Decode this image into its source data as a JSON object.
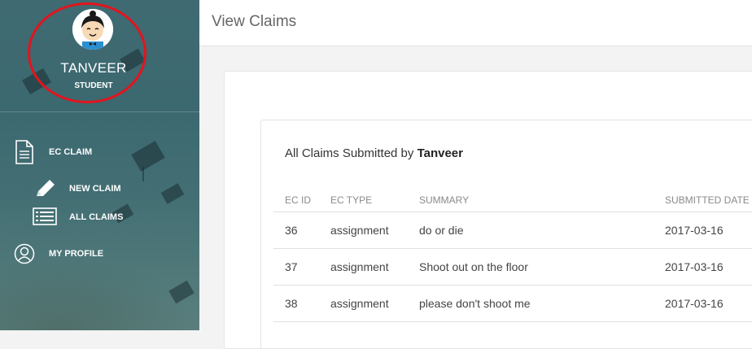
{
  "sidebar": {
    "user": {
      "name": "TANVEER",
      "role": "STUDENT"
    },
    "nav": {
      "ec_claim": "EC CLAIM",
      "new_claim": "NEW CLAIM",
      "all_claims": "ALL CLAIMS",
      "my_profile": "MY PROFILE"
    },
    "annotation_color": "#e3141d"
  },
  "header": {
    "title": "View Claims"
  },
  "claims": {
    "heading_prefix": "All Claims Submitted by ",
    "heading_name": "Tanveer",
    "columns": [
      "EC ID",
      "EC TYPE",
      "SUMMARY",
      "SUBMITTED DATE"
    ],
    "rows": [
      {
        "ec_id": "36",
        "ec_type": "assignment",
        "summary": "do or die",
        "date": "2017-03-16"
      },
      {
        "ec_id": "37",
        "ec_type": "assignment",
        "summary": "Shoot out on the floor",
        "date": "2017-03-16"
      },
      {
        "ec_id": "38",
        "ec_type": "assignment",
        "summary": "please don't shoot me",
        "date": "2017-03-16"
      }
    ]
  }
}
